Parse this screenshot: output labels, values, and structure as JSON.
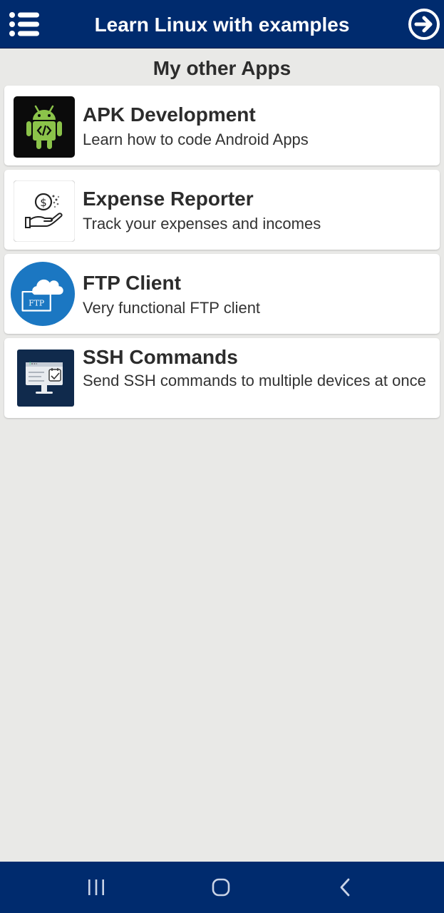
{
  "appbar": {
    "title": "Learn Linux with examples",
    "menu_icon": "menu-list-icon",
    "next_icon": "arrow-circle-right-icon"
  },
  "section": {
    "title": "My other Apps"
  },
  "apps": [
    {
      "name": "APK Development",
      "description": "Learn how to code Android Apps",
      "icon": "android-code-icon"
    },
    {
      "name": "Expense Reporter",
      "description": "Track your expenses and incomes",
      "icon": "money-hand-icon"
    },
    {
      "name": "FTP Client",
      "description": "Very functional FTP client",
      "icon": "ftp-cloud-folder-icon"
    },
    {
      "name": "SSH Commands",
      "description": "Send SSH commands to multiple devices at once",
      "icon": "terminal-monitor-icon"
    }
  ],
  "navbar": {
    "recents_icon": "recents-icon",
    "home_icon": "home-icon",
    "back_icon": "back-icon"
  },
  "colors": {
    "primary": "#002b6e",
    "background": "#e9e9e7",
    "card": "#ffffff",
    "text": "#2c2c2c"
  }
}
